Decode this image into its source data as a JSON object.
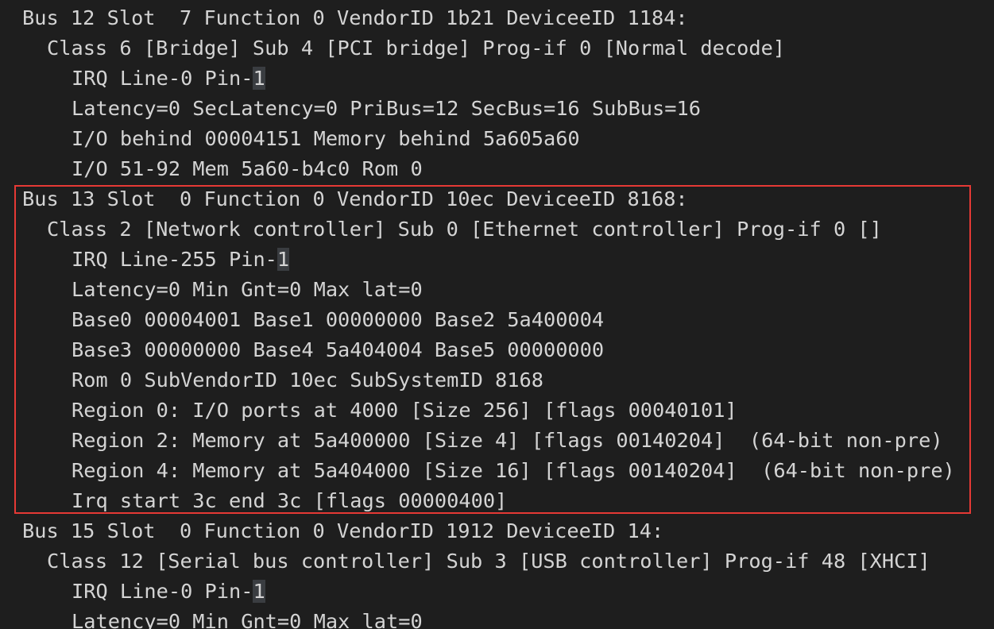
{
  "lines": [
    {
      "indent": 0,
      "text": "Bus 12 Slot  7 Function 0 VendorID 1b21 DeviceeID 1184:"
    },
    {
      "indent": 1,
      "text": "Class 6 [Bridge] Sub 4 [PCI bridge] Prog-if 0 [Normal decode]"
    },
    {
      "indent": 2,
      "text": "IRQ Line-0 Pin-",
      "highlight": "1"
    },
    {
      "indent": 2,
      "text": "Latency=0 SecLatency=0 PriBus=12 SecBus=16 SubBus=16"
    },
    {
      "indent": 2,
      "text": "I/O behind 00004151 Memory behind 5a605a60"
    },
    {
      "indent": 2,
      "text": "I/O 51-92 Mem 5a60-b4c0 Rom 0"
    },
    {
      "indent": 0,
      "text": "Bus 13 Slot  0 Function 0 VendorID 10ec DeviceeID 8168:"
    },
    {
      "indent": 1,
      "text": "Class 2 [Network controller] Sub 0 [Ethernet controller] Prog-if 0 []"
    },
    {
      "indent": 2,
      "text": "IRQ Line-255 Pin-",
      "highlight": "1"
    },
    {
      "indent": 2,
      "text": "Latency=0 Min Gnt=0 Max lat=0"
    },
    {
      "indent": 2,
      "text": "Base0 00004001 Base1 00000000 Base2 5a400004"
    },
    {
      "indent": 2,
      "text": "Base3 00000000 Base4 5a404004 Base5 00000000"
    },
    {
      "indent": 2,
      "text": "Rom 0 SubVendorID 10ec SubSystemID 8168"
    },
    {
      "indent": 2,
      "text": "Region 0: I/O ports at 4000 [Size 256] [flags 00040101]"
    },
    {
      "indent": 2,
      "text": "Region 2: Memory at 5a400000 [Size 4] [flags 00140204]  (64-bit non-pre)"
    },
    {
      "indent": 2,
      "text": "Region 4: Memory at 5a404000 [Size 16] [flags 00140204]  (64-bit non-pre)"
    },
    {
      "indent": 2,
      "text": "Irq start 3c end 3c [flags 00000400]"
    },
    {
      "indent": 0,
      "text": "Bus 15 Slot  0 Function 0 VendorID 1912 DeviceeID 14:"
    },
    {
      "indent": 1,
      "text": "Class 12 [Serial bus controller] Sub 3 [USB controller] Prog-if 48 [XHCI]"
    },
    {
      "indent": 2,
      "text": "IRQ Line-0 Pin-",
      "highlight": "1"
    },
    {
      "indent": 2,
      "text": "Latency=0 Min Gnt=0 Max lat=0"
    }
  ],
  "highlight_box": {
    "color": "#e53935",
    "first_line": 6,
    "last_line": 16
  }
}
